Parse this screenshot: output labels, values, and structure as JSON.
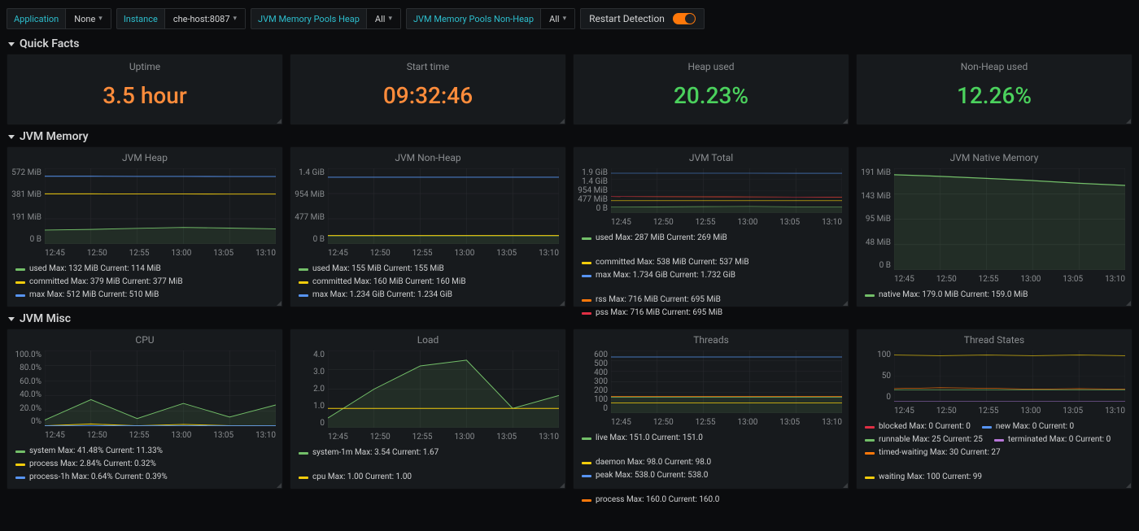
{
  "varbar": {
    "application": {
      "label": "Application",
      "value": "None"
    },
    "instance": {
      "label": "Instance",
      "value": "che-host:8087"
    },
    "heap": {
      "label": "JVM Memory Pools Heap",
      "value": "All"
    },
    "nonheap": {
      "label": "JVM Memory Pools Non-Heap",
      "value": "All"
    },
    "restart": {
      "label": "Restart Detection"
    }
  },
  "sections": {
    "quick_facts": "Quick Facts",
    "jvm_memory": "JVM Memory",
    "jvm_misc": "JVM Misc"
  },
  "stats": {
    "uptime": {
      "label": "Uptime",
      "value": "3.5 hour",
      "tone": "orange"
    },
    "start": {
      "label": "Start time",
      "value": "09:32:46",
      "tone": "orange"
    },
    "heap": {
      "label": "Heap used",
      "value": "20.23%",
      "tone": "green"
    },
    "nonheap": {
      "label": "Non-Heap used",
      "value": "12.26%",
      "tone": "green"
    }
  },
  "xaxis": [
    "12:45",
    "12:50",
    "12:55",
    "13:00",
    "13:05",
    "13:10"
  ],
  "charts": {
    "jvm_heap": {
      "title": "JVM Heap",
      "yticks": [
        "572 MiB",
        "381 MiB",
        "191 MiB",
        "0 B"
      ],
      "legend": [
        {
          "color": "#73bf69",
          "name": "used",
          "max": "132 MiB",
          "cur": "114 MiB"
        },
        {
          "color": "#f2cc0c",
          "name": "committed",
          "max": "379 MiB",
          "cur": "377 MiB"
        },
        {
          "color": "#5794f2",
          "name": "max",
          "max": "512 MiB",
          "cur": "510 MiB"
        }
      ]
    },
    "jvm_nonheap": {
      "title": "JVM Non-Heap",
      "yticks": [
        "1.4 GiB",
        "954 MiB",
        "477 MiB",
        "0 B"
      ],
      "legend": [
        {
          "color": "#73bf69",
          "name": "used",
          "max": "155 MiB",
          "cur": "155 MiB"
        },
        {
          "color": "#f2cc0c",
          "name": "committed",
          "max": "160 MiB",
          "cur": "160 MiB"
        },
        {
          "color": "#5794f2",
          "name": "max",
          "max": "1.234 GiB",
          "cur": "1.234 GiB"
        }
      ]
    },
    "jvm_total": {
      "title": "JVM Total",
      "yticks": [
        "1.9 GiB",
        "1.4 GiB",
        "954 MiB",
        "477 MiB",
        "0 B"
      ],
      "legend": [
        {
          "color": "#73bf69",
          "name": "used",
          "max": "287 MiB",
          "cur": "269 MiB"
        },
        {
          "color": "#f2cc0c",
          "name": "committed",
          "max": "538 MiB",
          "cur": "537 MiB"
        },
        {
          "color": "#5794f2",
          "name": "max",
          "max": "1.734 GiB",
          "cur": "1.732 GiB"
        },
        {
          "color": "#ff780a",
          "name": "rss",
          "max": "716 MiB",
          "cur": "695 MiB"
        },
        {
          "color": "#e02f44",
          "name": "pss",
          "max": "716 MiB",
          "cur": "695 MiB"
        }
      ]
    },
    "jvm_native": {
      "title": "JVM Native Memory",
      "yticks": [
        "191 MiB",
        "143 MiB",
        "95 MiB",
        "48 MiB",
        "0 B"
      ],
      "legend": [
        {
          "color": "#73bf69",
          "name": "native",
          "max": "179.0 MiB",
          "cur": "159.0 MiB"
        }
      ]
    },
    "cpu": {
      "title": "CPU",
      "yticks": [
        "100.0%",
        "80.0%",
        "60.0%",
        "40.0%",
        "20.0%",
        "0%"
      ],
      "legend": [
        {
          "color": "#73bf69",
          "name": "system",
          "max": "41.48%",
          "cur": "11.33%"
        },
        {
          "color": "#f2cc0c",
          "name": "process",
          "max": "2.84%",
          "cur": "0.32%"
        },
        {
          "color": "#5794f2",
          "name": "process-1h",
          "max": "0.64%",
          "cur": "0.39%"
        }
      ]
    },
    "load": {
      "title": "Load",
      "yticks": [
        "4.0",
        "3.0",
        "2.0",
        "1.0",
        "0"
      ],
      "legend": [
        {
          "color": "#73bf69",
          "name": "system-1m",
          "max": "3.54",
          "cur": "1.67"
        },
        {
          "color": "#f2cc0c",
          "name": "cpu",
          "max": "1.00",
          "cur": "1.00"
        }
      ]
    },
    "threads": {
      "title": "Threads",
      "yticks": [
        "600",
        "500",
        "400",
        "300",
        "200",
        "100",
        "0"
      ],
      "legend": [
        {
          "color": "#73bf69",
          "name": "live",
          "max": "151.0",
          "cur": "151.0"
        },
        {
          "color": "#f2cc0c",
          "name": "daemon",
          "max": "98.0",
          "cur": "98.0"
        },
        {
          "color": "#5794f2",
          "name": "peak",
          "max": "538.0",
          "cur": "538.0"
        },
        {
          "color": "#ff780a",
          "name": "process",
          "max": "160.0",
          "cur": "160.0"
        }
      ]
    },
    "thread_states": {
      "title": "Thread States",
      "yticks": [
        "100",
        "50",
        "0"
      ],
      "legend": [
        {
          "color": "#e02f44",
          "name": "blocked",
          "max": "0",
          "cur": "0"
        },
        {
          "color": "#5794f2",
          "name": "new",
          "max": "0",
          "cur": "0"
        },
        {
          "color": "#73bf69",
          "name": "runnable",
          "max": "25",
          "cur": "25"
        },
        {
          "color": "#b877d9",
          "name": "terminated",
          "max": "0",
          "cur": "0"
        },
        {
          "color": "#ff780a",
          "name": "timed-waiting",
          "max": "30",
          "cur": "27"
        },
        {
          "color": "#f2cc0c",
          "name": "waiting",
          "max": "100",
          "cur": "99"
        }
      ]
    }
  },
  "chart_data": [
    {
      "id": "jvm_heap",
      "type": "line",
      "title": "JVM Heap",
      "xlabel": "",
      "ylabel": "bytes",
      "ylim": [
        0,
        572
      ],
      "yunit": "MiB",
      "x": [
        "12:45",
        "12:50",
        "12:55",
        "13:00",
        "13:05",
        "13:10"
      ],
      "series": [
        {
          "name": "used",
          "values": [
            105,
            110,
            118,
            125,
            120,
            114
          ],
          "color": "#73bf69"
        },
        {
          "name": "committed",
          "values": [
            379,
            379,
            378,
            378,
            377,
            377
          ],
          "color": "#f2cc0c"
        },
        {
          "name": "max",
          "values": [
            512,
            512,
            511,
            511,
            510,
            510
          ],
          "color": "#5794f2"
        }
      ]
    },
    {
      "id": "jvm_nonheap",
      "type": "line",
      "title": "JVM Non-Heap",
      "xlabel": "",
      "ylabel": "bytes",
      "ylim": [
        0,
        1433
      ],
      "yunit": "MiB",
      "x": [
        "12:45",
        "12:50",
        "12:55",
        "13:00",
        "13:05",
        "13:10"
      ],
      "series": [
        {
          "name": "used",
          "values": [
            155,
            155,
            155,
            155,
            155,
            155
          ],
          "color": "#73bf69"
        },
        {
          "name": "committed",
          "values": [
            160,
            160,
            160,
            160,
            160,
            160
          ],
          "color": "#f2cc0c"
        },
        {
          "name": "max",
          "values": [
            1264,
            1264,
            1264,
            1264,
            1264,
            1264
          ],
          "color": "#5794f2"
        }
      ]
    },
    {
      "id": "jvm_total",
      "type": "line",
      "title": "JVM Total",
      "xlabel": "",
      "ylabel": "bytes",
      "ylim": [
        0,
        1946
      ],
      "yunit": "MiB",
      "x": [
        "12:45",
        "12:50",
        "12:55",
        "13:00",
        "13:05",
        "13:10"
      ],
      "series": [
        {
          "name": "used",
          "values": [
            265,
            272,
            280,
            287,
            275,
            269
          ],
          "color": "#73bf69"
        },
        {
          "name": "committed",
          "values": [
            538,
            538,
            538,
            537,
            537,
            537
          ],
          "color": "#f2cc0c"
        },
        {
          "name": "max",
          "values": [
            1734,
            1734,
            1733,
            1733,
            1732,
            1732
          ],
          "color": "#5794f2"
        },
        {
          "name": "rss",
          "values": [
            716,
            712,
            708,
            702,
            698,
            695
          ],
          "color": "#ff780a"
        },
        {
          "name": "pss",
          "values": [
            716,
            712,
            708,
            702,
            698,
            695
          ],
          "color": "#e02f44"
        }
      ]
    },
    {
      "id": "jvm_native",
      "type": "line",
      "title": "JVM Native Memory",
      "xlabel": "",
      "ylabel": "bytes",
      "ylim": [
        0,
        191
      ],
      "yunit": "MiB",
      "x": [
        "12:45",
        "12:50",
        "12:55",
        "13:00",
        "13:05",
        "13:10"
      ],
      "series": [
        {
          "name": "native",
          "values": [
            179,
            176,
            172,
            168,
            163,
            159
          ],
          "color": "#73bf69"
        }
      ]
    },
    {
      "id": "cpu",
      "type": "line",
      "title": "CPU",
      "xlabel": "",
      "ylabel": "%",
      "ylim": [
        0,
        100
      ],
      "x": [
        "12:45",
        "12:50",
        "12:55",
        "13:00",
        "13:05",
        "13:10"
      ],
      "series": [
        {
          "name": "system",
          "values": [
            8,
            35,
            10,
            30,
            12,
            28
          ],
          "color": "#73bf69"
        },
        {
          "name": "process",
          "values": [
            0.5,
            2.8,
            0.4,
            2.2,
            0.6,
            0.3
          ],
          "color": "#f2cc0c"
        },
        {
          "name": "process-1h",
          "values": [
            0.4,
            0.5,
            0.6,
            0.64,
            0.5,
            0.39
          ],
          "color": "#5794f2"
        }
      ]
    },
    {
      "id": "load",
      "type": "line",
      "title": "Load",
      "xlabel": "",
      "ylabel": "",
      "ylim": [
        0,
        4
      ],
      "x": [
        "12:45",
        "12:50",
        "12:55",
        "13:00",
        "13:05",
        "13:10"
      ],
      "series": [
        {
          "name": "system-1m",
          "values": [
            0.5,
            2.0,
            3.2,
            3.5,
            1.0,
            1.67
          ],
          "color": "#73bf69"
        },
        {
          "name": "cpu",
          "values": [
            1.0,
            1.0,
            1.0,
            1.0,
            1.0,
            1.0
          ],
          "color": "#f2cc0c"
        }
      ]
    },
    {
      "id": "threads",
      "type": "line",
      "title": "Threads",
      "xlabel": "",
      "ylabel": "",
      "ylim": [
        0,
        600
      ],
      "x": [
        "12:45",
        "12:50",
        "12:55",
        "13:00",
        "13:05",
        "13:10"
      ],
      "series": [
        {
          "name": "live",
          "values": [
            151,
            151,
            151,
            151,
            151,
            151
          ],
          "color": "#73bf69"
        },
        {
          "name": "daemon",
          "values": [
            98,
            98,
            98,
            98,
            98,
            98
          ],
          "color": "#f2cc0c"
        },
        {
          "name": "peak",
          "values": [
            538,
            538,
            538,
            538,
            538,
            538
          ],
          "color": "#5794f2"
        },
        {
          "name": "process",
          "values": [
            160,
            160,
            160,
            160,
            160,
            160
          ],
          "color": "#ff780a"
        }
      ]
    },
    {
      "id": "thread_states",
      "type": "line",
      "title": "Thread States",
      "xlabel": "",
      "ylabel": "",
      "ylim": [
        0,
        110
      ],
      "x": [
        "12:45",
        "12:50",
        "12:55",
        "13:00",
        "13:05",
        "13:10"
      ],
      "series": [
        {
          "name": "blocked",
          "values": [
            0,
            0,
            0,
            0,
            0,
            0
          ],
          "color": "#e02f44"
        },
        {
          "name": "new",
          "values": [
            0,
            0,
            0,
            0,
            0,
            0
          ],
          "color": "#5794f2"
        },
        {
          "name": "runnable",
          "values": [
            25,
            25,
            25,
            25,
            25,
            25
          ],
          "color": "#73bf69"
        },
        {
          "name": "terminated",
          "values": [
            0,
            0,
            0,
            0,
            0,
            0
          ],
          "color": "#b877d9"
        },
        {
          "name": "timed-waiting",
          "values": [
            28,
            30,
            29,
            27,
            28,
            27
          ],
          "color": "#ff780a"
        },
        {
          "name": "waiting",
          "values": [
            100,
            99,
            100,
            99,
            100,
            99
          ],
          "color": "#f2cc0c"
        }
      ]
    }
  ]
}
